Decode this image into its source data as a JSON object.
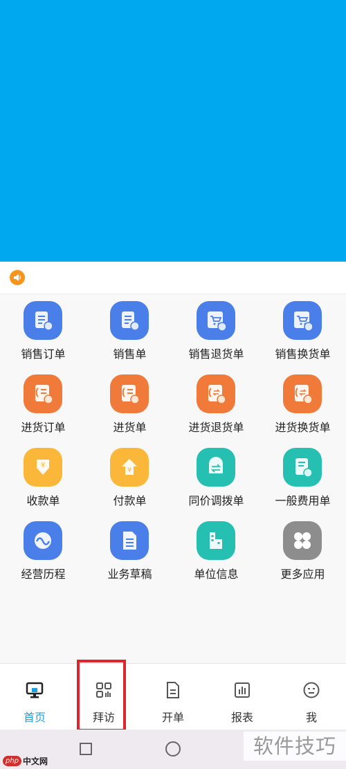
{
  "colors": {
    "banner": "#00a9ef",
    "active_tab": "#1aa3e2",
    "highlight": "#e0242b"
  },
  "notice": {
    "icon": "speaker-icon"
  },
  "grid": [
    {
      "label": "销售订单",
      "icon": "sales-order-icon",
      "color": "blue"
    },
    {
      "label": "销售单",
      "icon": "sales-slip-icon",
      "color": "blue"
    },
    {
      "label": "销售退货单",
      "icon": "sales-return-icon",
      "color": "blue"
    },
    {
      "label": "销售换货单",
      "icon": "sales-exchange-icon",
      "color": "blue"
    },
    {
      "label": "进货订单",
      "icon": "purchase-order-icon",
      "color": "orange"
    },
    {
      "label": "进货单",
      "icon": "purchase-slip-icon",
      "color": "orange"
    },
    {
      "label": "进货退货单",
      "icon": "purchase-return-icon",
      "color": "orange"
    },
    {
      "label": "进货换货单",
      "icon": "purchase-exchange-icon",
      "color": "orange"
    },
    {
      "label": "收款单",
      "icon": "receipt-icon",
      "color": "yellow"
    },
    {
      "label": "付款单",
      "icon": "payment-icon",
      "color": "yellow"
    },
    {
      "label": "同价调拨单",
      "icon": "transfer-icon",
      "color": "teal"
    },
    {
      "label": "一般费用单",
      "icon": "expense-icon",
      "color": "teal"
    },
    {
      "label": "经营历程",
      "icon": "history-icon",
      "color": "blue"
    },
    {
      "label": "业务草稿",
      "icon": "draft-icon",
      "color": "blue"
    },
    {
      "label": "单位信息",
      "icon": "unit-info-icon",
      "color": "teal"
    },
    {
      "label": "更多应用",
      "icon": "more-apps-icon",
      "color": "grey"
    }
  ],
  "tabs": [
    {
      "label": "首页",
      "icon": "monitor-icon",
      "active": true
    },
    {
      "label": "拜访",
      "icon": "qr-code-icon",
      "active": false
    },
    {
      "label": "开单",
      "icon": "document-icon",
      "active": false
    },
    {
      "label": "报表",
      "icon": "bar-chart-icon",
      "active": false
    },
    {
      "label": "我",
      "icon": "smiley-icon",
      "active": false
    }
  ],
  "system_nav": {
    "recents": "square-icon",
    "home": "circle-icon"
  },
  "watermark": {
    "text": "软件技巧"
  },
  "site_logo": {
    "badge": "php",
    "text": "中文网"
  }
}
